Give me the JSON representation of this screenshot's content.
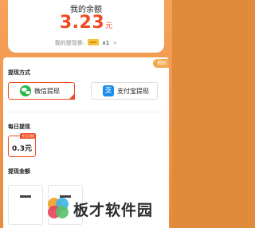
{
  "balance": {
    "title": "我的余额",
    "amount": "3.23",
    "unit": "元",
    "voucher_label": "我的提现券:",
    "voucher_count": "x1",
    "voucher_arrow": ">"
  },
  "rules_badge": "规则",
  "withdraw_method": {
    "title": "提现方式",
    "options": [
      {
        "label": "微信提现",
        "icon": "wechat-icon",
        "selected": true
      },
      {
        "label": "支付宝提现",
        "icon": "alipay-icon",
        "selected": false
      }
    ]
  },
  "daily_withdraw": {
    "title": "每日提现",
    "tag": "今日可提",
    "amount_label": "0.3元"
  },
  "withdraw_amount": {
    "title": "提现金额"
  },
  "watermark": {
    "text": "板才软件园"
  },
  "colors": {
    "accent": "#ee4b25",
    "background": "#e88c3e",
    "wechat": "#29b84a",
    "alipay": "#1a8ceb"
  }
}
